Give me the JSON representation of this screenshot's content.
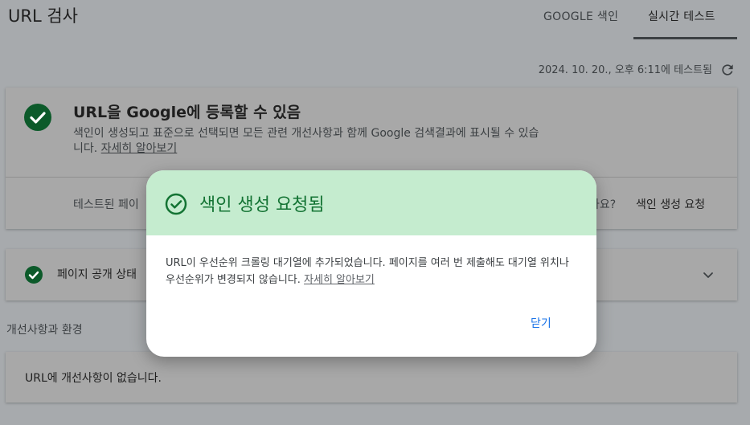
{
  "header": {
    "title": "URL 검사",
    "tabs": [
      {
        "label": "GOOGLE 색인"
      },
      {
        "label": "실시간 테스트"
      }
    ],
    "test_time": "2024. 10. 20., 오후 6:11에 테스트됨"
  },
  "status_card": {
    "title": "URL을 Google에 등록할 수 있음",
    "desc": "색인이 생성되고 표준으로 선택되면 모든 관련 개선사항과 함께 Google 검색결과에 표시될 수 있습니다.",
    "learn_more": "자세히 알아보기",
    "tested_page_partial": "테스트된 페이",
    "question_partial": "나요?",
    "request_index": "색인 생성 요청"
  },
  "availability_card": {
    "label_partial": "페이지 공개 상태"
  },
  "enhancements": {
    "section_label": "개선사항과 환경",
    "text": "URL에 개선사항이 없습니다."
  },
  "dialog": {
    "title": "색인 생성 요청됨",
    "body": "URL이 우선순위 크롤링 대기열에 추가되었습니다. 페이지를 여러 번 제출해도 대기열 위치나 우선순위가 변경되지 않습니다.",
    "learn_more": "자세히 알아보기",
    "close_label": "닫기"
  },
  "colors": {
    "success_green": "#137333",
    "dialog_header": "#c5eccf",
    "link_blue": "#1a73e8"
  },
  "icons": [
    "check-circle-icon",
    "refresh-icon",
    "chevron-down-icon",
    "check-circle-outline-icon"
  ]
}
